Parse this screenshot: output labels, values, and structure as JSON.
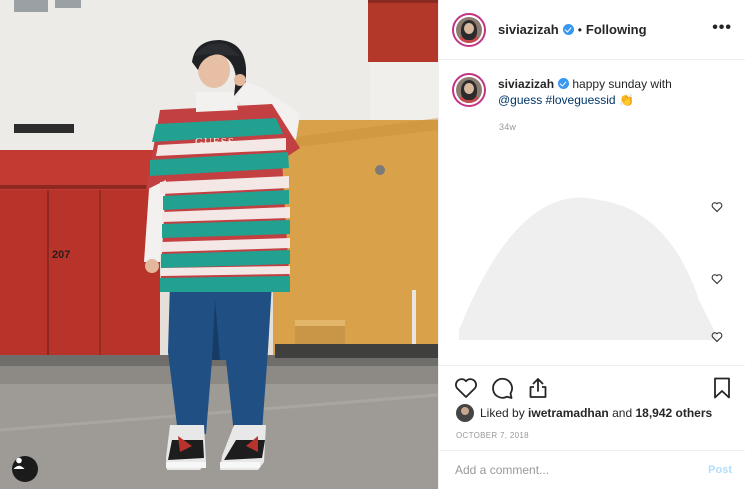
{
  "post": {
    "photo_alt": "Instagram post photo",
    "header": {
      "username": "siviazizah",
      "separator": "•",
      "follow_state": "Following",
      "more_label": "•••"
    },
    "caption": {
      "username": "siviazizah",
      "text_before": "happy sunday with",
      "mention": "@guess",
      "hashtag": "#loveguessid",
      "emoji": "👏",
      "time": "34w"
    },
    "likes": {
      "prefix": "Liked by",
      "user": "iwetramadhan",
      "middle": "and",
      "count": "18,942 others"
    },
    "date": "OCTOBER 7, 2018",
    "comment": {
      "placeholder": "Add a comment...",
      "post_label": "Post"
    }
  },
  "icons": {
    "user_tags": "user-tag-icon",
    "verified": "verified-badge-icon",
    "like": "heart-icon",
    "comment": "comment-icon",
    "share": "share-icon",
    "save": "bookmark-icon",
    "comment_like": "heart-small-icon"
  },
  "colors": {
    "verified": "#3897f0",
    "link": "#003569",
    "muted": "#999999",
    "post_disabled": "#b2dffc",
    "story_ring": "#c13584"
  }
}
